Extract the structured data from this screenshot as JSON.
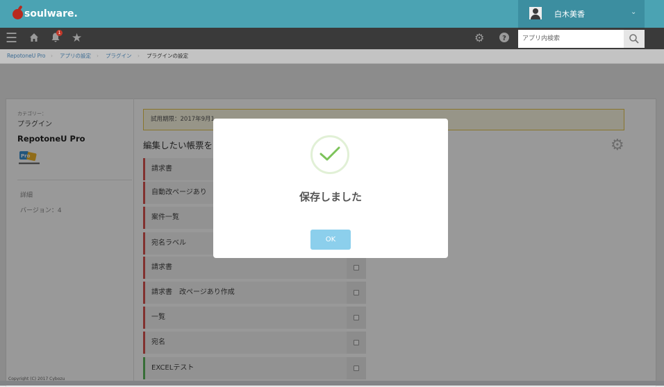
{
  "header": {
    "brand": "soulware.",
    "user_name": "白木美香",
    "search_placeholder": "アプリ内検索",
    "notification_count": "1"
  },
  "breadcrumb": [
    {
      "label": "RepotoneU Pro"
    },
    {
      "label": "アプリの設定"
    },
    {
      "label": "プラグイン"
    },
    {
      "label": "プラグインの設定"
    }
  ],
  "sidebar": {
    "category_label": "カテゴリー：",
    "category_value": "プラグイン",
    "plugin_name": "RepotoneU Pro",
    "detail_label": "詳細",
    "version": "バージョン：4"
  },
  "main": {
    "trial_notice": "試用期限：2017年9月1",
    "edit_heading": "編集したい帳票を",
    "rows": [
      {
        "label": "請求書",
        "accent": "red"
      },
      {
        "label": "自動改ページあり",
        "accent": "red"
      },
      {
        "label": "案件一覧",
        "accent": "red"
      },
      {
        "label": "宛名ラベル",
        "accent": "red"
      },
      {
        "label": "請求書",
        "accent": "red"
      },
      {
        "label": "請求書　改ページあり作成",
        "accent": "red"
      },
      {
        "label": "一覧",
        "accent": "red"
      },
      {
        "label": "宛名",
        "accent": "red"
      },
      {
        "label": "EXCELテスト",
        "accent": "green"
      }
    ]
  },
  "footer": {
    "copyright": "Copyright (C) 2017 Cybozu"
  },
  "modal": {
    "title": "保存しました",
    "ok_label": "OK",
    "check_color": "#7cc35a",
    "button_color": "#8ccfec"
  },
  "colors": {
    "header_teal": "#4ba3b3",
    "nav_dark": "#3a3a3a",
    "row_accent_red": "#d9534f",
    "row_accent_green": "#5cb85c"
  }
}
